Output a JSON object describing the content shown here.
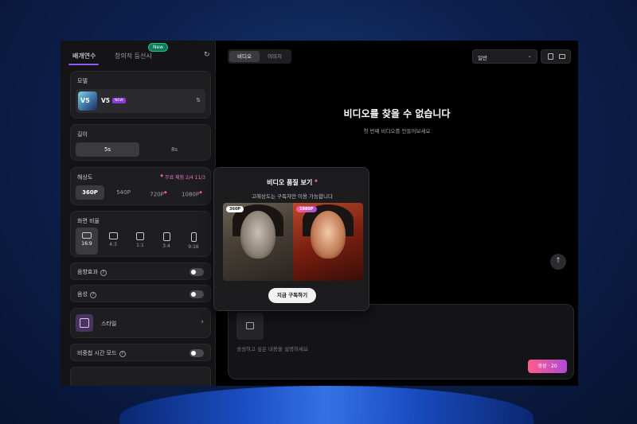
{
  "left_panel": {
    "tabs": [
      {
        "label": "배개연수"
      },
      {
        "label": "창의적 등선시"
      }
    ],
    "new_badge": "New",
    "model": {
      "label": "모델",
      "name": "V5",
      "badge": "NEW",
      "thumb_text": "V5"
    },
    "length": {
      "label": "길이",
      "options": [
        "5s",
        "8s"
      ],
      "selected": "5s"
    },
    "resolution": {
      "label": "해상도",
      "free_label": "무료 체험 2/4 11/3",
      "options": [
        "360P",
        "540P",
        "720P",
        "1080P"
      ],
      "selected": "360P"
    },
    "ratio": {
      "label": "화면 비율",
      "options": [
        "16:9",
        "4:3",
        "1:1",
        "3:4",
        "9:16"
      ],
      "selected": "16:9"
    },
    "toggles": [
      {
        "label": "음향효과"
      },
      {
        "label": "음성"
      }
    ],
    "style": {
      "label": "스타일"
    },
    "toggle_extra": {
      "label": "비중첩 시간 모드"
    }
  },
  "right_panel": {
    "tabs": [
      "비디오",
      "이미지"
    ],
    "selected_tab": "비디오",
    "dropdown_value": "일반",
    "empty_title": "비디오를 찾을 수 없습니다",
    "empty_subtitle": "첫 번째 비디오를 만들어보세요",
    "prompt_placeholder": "생성하고 싶은 내용을 설명하세요",
    "generate_label": "생성 · 20"
  },
  "popup": {
    "title": "비디오 품질 보기",
    "subtitle": "고해상도는 구독자만 이용 가능합니다",
    "left_badge": "360P",
    "right_badge": "1080P",
    "button": "지금 구독하기"
  },
  "colors": {
    "accent": "#8b5cf6",
    "gradient_start": "#ff5c8a",
    "gradient_end": "#b04bd8",
    "new_badge": "#0f7a5a"
  }
}
